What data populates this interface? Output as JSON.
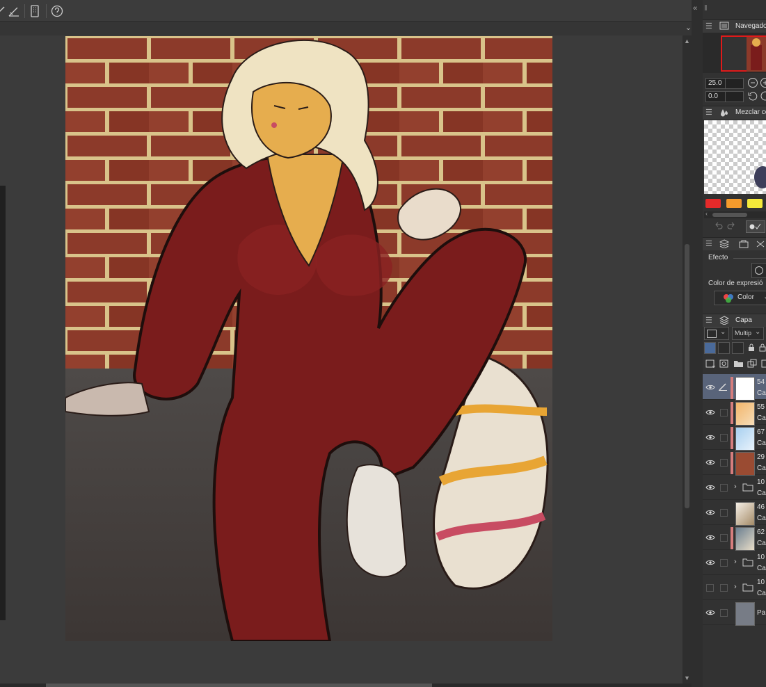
{
  "panels": {
    "navigator": {
      "title": "Navegado",
      "zoom_value": "25.0",
      "rotation_value": "0.0"
    },
    "color_mixing": {
      "title": "Mezclar cc",
      "swatches": [
        "#e52a2a",
        "#f59b2c",
        "#f4e93a"
      ]
    },
    "properties": {
      "effect_label": "Efecto",
      "expression_color_label": "Color de expresió",
      "expression_color_value": "Color"
    },
    "layers": {
      "title": "Capa",
      "blend_mode": "Multip",
      "rows": [
        {
          "t1": "54",
          "t2": "Ca",
          "type": "layer",
          "visible": true,
          "selected": true,
          "marked": true,
          "thumb": "sketch"
        },
        {
          "t1": "55",
          "t2": "Ca",
          "type": "layer",
          "visible": true,
          "selected": false,
          "marked": true,
          "thumb": "orange-grad"
        },
        {
          "t1": "67",
          "t2": "Ca",
          "type": "layer",
          "visible": true,
          "selected": false,
          "marked": true,
          "thumb": "blue-check"
        },
        {
          "t1": "29",
          "t2": "Ca",
          "type": "layer",
          "visible": true,
          "selected": false,
          "marked": true,
          "thumb": "brick"
        },
        {
          "t1": "10",
          "t2": "Ca",
          "type": "folder",
          "visible": true,
          "selected": false,
          "marked": false,
          "thumb": ""
        },
        {
          "t1": "46",
          "t2": "Ca",
          "type": "layer",
          "visible": true,
          "selected": false,
          "marked": false,
          "thumb": "brown-check"
        },
        {
          "t1": "62",
          "t2": "Ca",
          "type": "layer",
          "visible": true,
          "selected": false,
          "marked": true,
          "thumb": "blue-grad"
        },
        {
          "t1": "10",
          "t2": "Ca",
          "type": "folder",
          "visible": true,
          "selected": false,
          "marked": false,
          "thumb": ""
        },
        {
          "t1": "10",
          "t2": "Ca",
          "type": "folder",
          "visible": false,
          "selected": false,
          "marked": false,
          "thumb": ""
        },
        {
          "t1": "Pa",
          "t2": "",
          "type": "paper",
          "visible": true,
          "selected": false,
          "marked": false,
          "thumb": "gray"
        }
      ]
    }
  }
}
